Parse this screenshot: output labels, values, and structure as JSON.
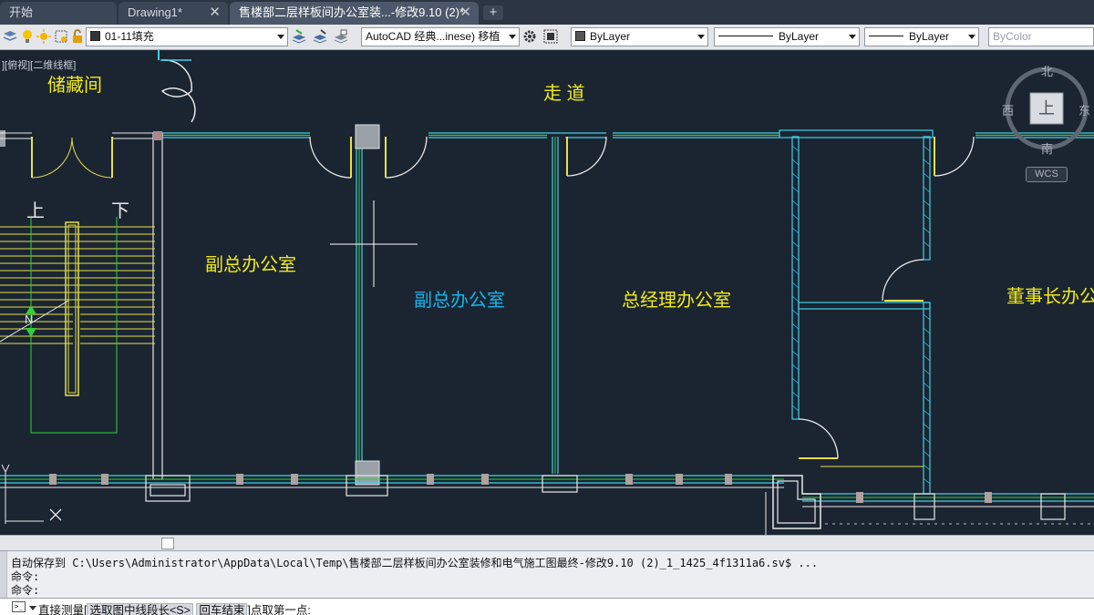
{
  "tabs": [
    {
      "label": "开始",
      "active": false,
      "closable": false
    },
    {
      "label": "Drawing1*",
      "active": false,
      "closable": true
    },
    {
      "label": "售楼部二层样板间办公室装...-修改9.10 (2)*",
      "active": true,
      "closable": true
    }
  ],
  "tab_add": "+",
  "toolbar": {
    "layer": "01-11填充",
    "annotation_scale": "AutoCAD 经典...inese) 移植",
    "color": "ByLayer",
    "linetype": "ByLayer",
    "lineweight": "ByLayer",
    "plotstyle": "ByColor"
  },
  "viewport_label": "][俯视][二维线框]",
  "rooms": {
    "storage": "储藏间",
    "corridor": "走 道",
    "vice_office_1": "副总办公室",
    "vice_office_2": "副总办公室",
    "gm_office": "总经理办公室",
    "chairman_office": "董事长办公"
  },
  "stairs": {
    "up": "上",
    "down": "下",
    "north_mark": "N"
  },
  "viewcube": {
    "north": "北",
    "south": "南",
    "east": "东",
    "west": "西",
    "face": "上",
    "wcs": "WCS"
  },
  "command": {
    "line1": "自动保存到 C:\\Users\\Administrator\\AppData\\Local\\Temp\\售楼部二层样板间办公室装修和电气施工图最终-修改9.10 (2)_1_1425_4f1311a6.sv$ ...",
    "line2": "命令:",
    "line3": "命令:",
    "prompt_prefix": "直接测量[",
    "option1": "选取图中线段长<S>",
    "option2": "回车结束",
    "prompt_suffix": "]点取第一点:",
    "prompt_icon": ">_"
  },
  "colors": {
    "background": "#1b2532",
    "wall_cyan": "#3fd0e6",
    "wall_green": "#2fd13a",
    "label_yellow": "#f0ea1a",
    "label_cyan": "#14b4ee"
  }
}
